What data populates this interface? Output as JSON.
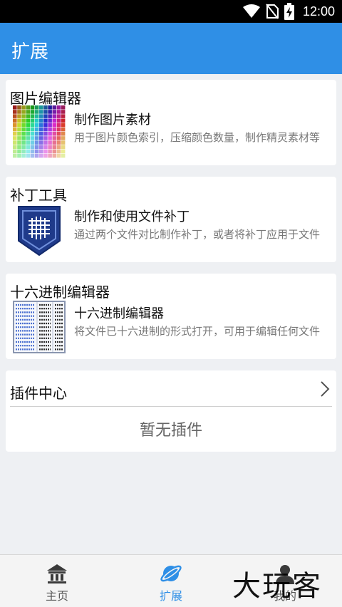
{
  "status_bar": {
    "time": "12:00",
    "icons": [
      "wifi-icon",
      "no-sim-icon",
      "battery-charging-icon"
    ]
  },
  "app_bar": {
    "title": "扩展"
  },
  "cards": [
    {
      "title": "图片编辑器",
      "icon": "color-palette-icon",
      "item_name": "制作图片素材",
      "item_desc": "用于图片颜色索引，压缩颜色数量，制作精灵素材等"
    },
    {
      "title": "补丁工具",
      "icon": "patch-icon",
      "item_name": "制作和使用文件补丁",
      "item_desc": "通过两个文件对比制作补丁，或者将补丁应用于文件"
    },
    {
      "title": "十六进制编辑器",
      "icon": "hex-editor-icon",
      "item_name": "十六进制编辑器",
      "item_desc": "将文件已十六进制的形式打开，可用于编辑任何文件"
    }
  ],
  "plugin_center": {
    "title": "插件中心",
    "empty_text": "暂无插件"
  },
  "bottom_nav": {
    "items": [
      {
        "label": "主页",
        "icon": "home-bank-icon",
        "active": false
      },
      {
        "label": "扩展",
        "icon": "planet-icon",
        "active": true
      },
      {
        "label": "我的",
        "icon": "user-icon",
        "active": false
      }
    ]
  },
  "watermark": "大玩客",
  "colors": {
    "primary": "#2f8fe6",
    "background": "#eef0f3",
    "card": "#ffffff",
    "desc_text": "#777777"
  }
}
